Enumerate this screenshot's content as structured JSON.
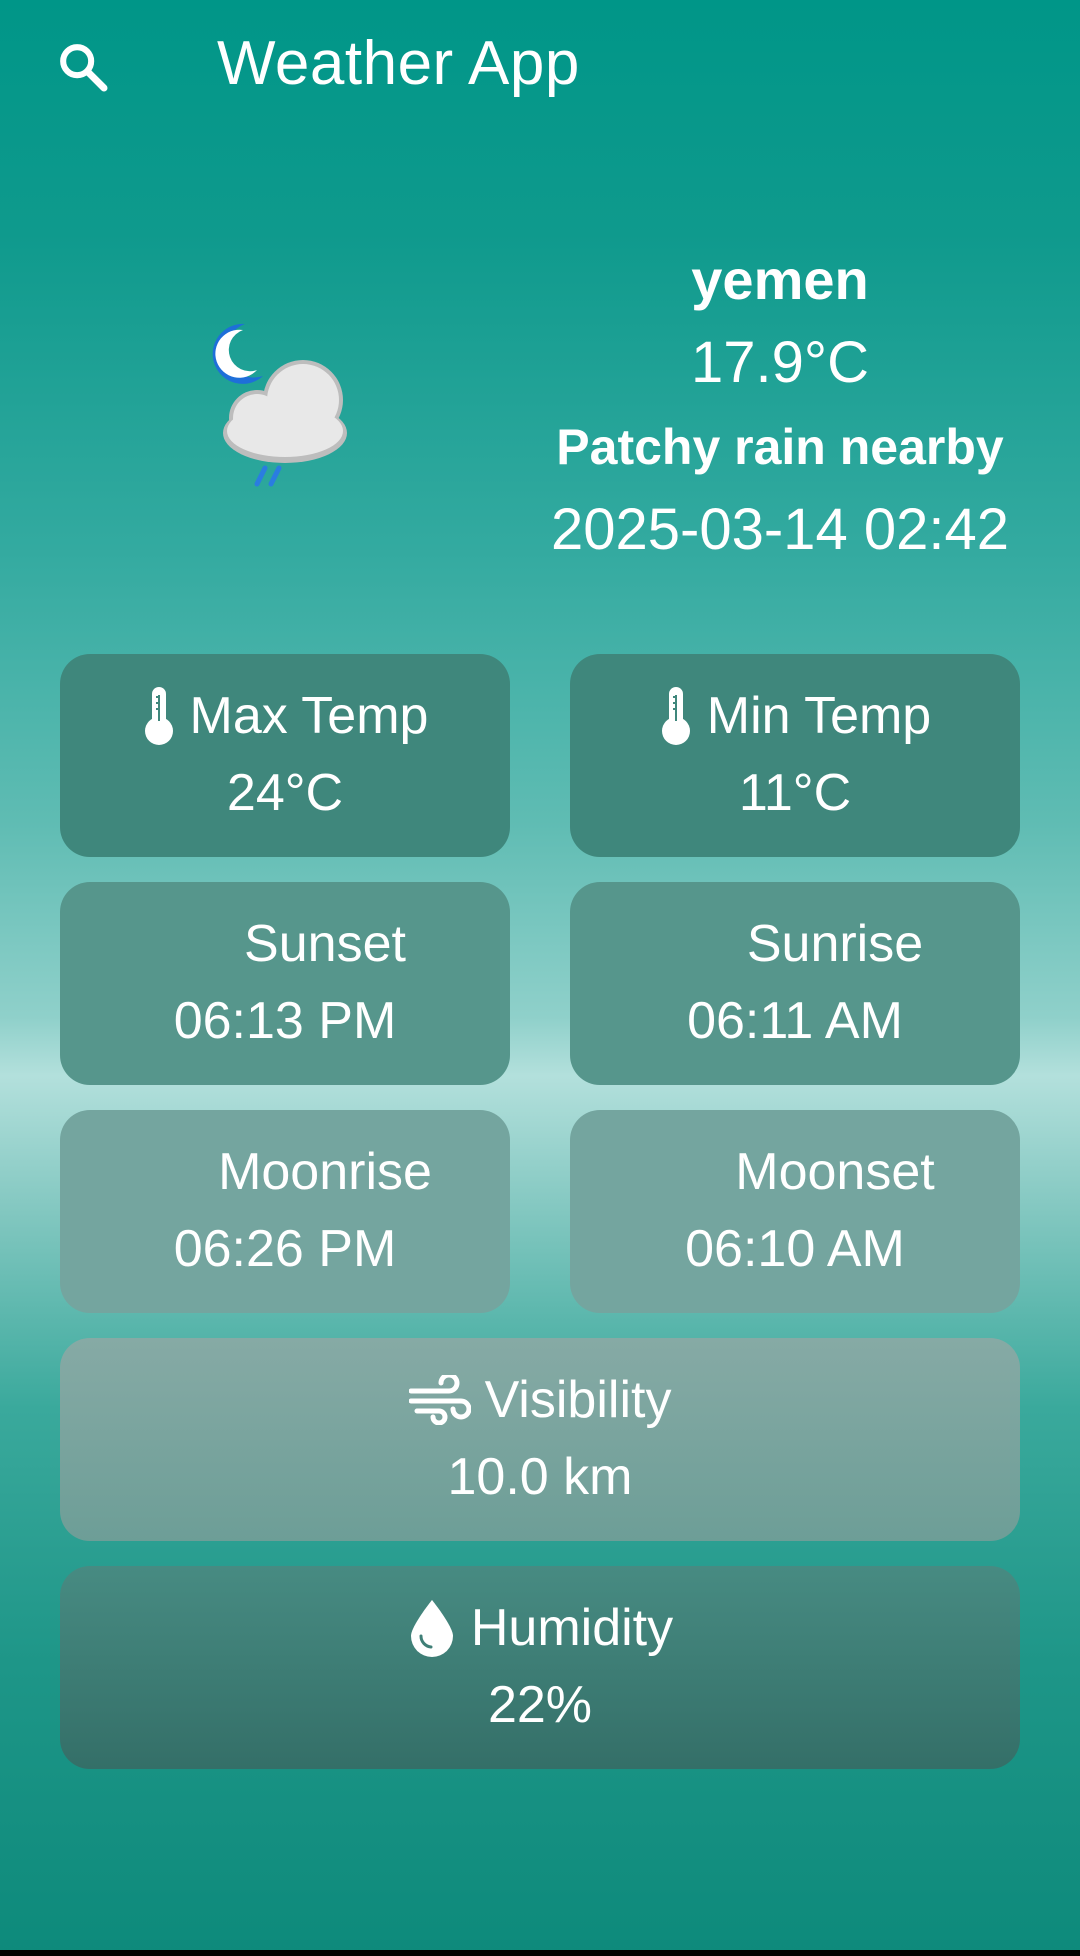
{
  "appbar": {
    "title": "Weather App",
    "search_icon": "search-icon"
  },
  "current": {
    "city": "yemen",
    "temperature": "17.9°C",
    "condition": "Patchy rain nearby",
    "datetime": "2025-03-14 02:42",
    "icon": "night-rain-cloud-icon"
  },
  "cards": {
    "max_temp": {
      "label": "Max Temp",
      "value": "24°C",
      "icon": "thermometer-icon"
    },
    "min_temp": {
      "label": "Min Temp",
      "value": "11°C",
      "icon": "thermometer-icon"
    },
    "sunset": {
      "label": "Sunset",
      "value": "06:13 PM"
    },
    "sunrise": {
      "label": "Sunrise",
      "value": "06:11 AM"
    },
    "moonrise": {
      "label": "Moonrise",
      "value": "06:26 PM"
    },
    "moonset": {
      "label": "Moonset",
      "value": "06:10 AM"
    },
    "visibility": {
      "label": "Visibility",
      "value": "10.0 km",
      "icon": "wind-icon"
    },
    "humidity": {
      "label": "Humidity",
      "value": "22%",
      "icon": "water-drop-icon"
    }
  },
  "colors": {
    "primary": "#009688",
    "moon": "#1e6fd9",
    "cloud": "#e6e6e6"
  }
}
